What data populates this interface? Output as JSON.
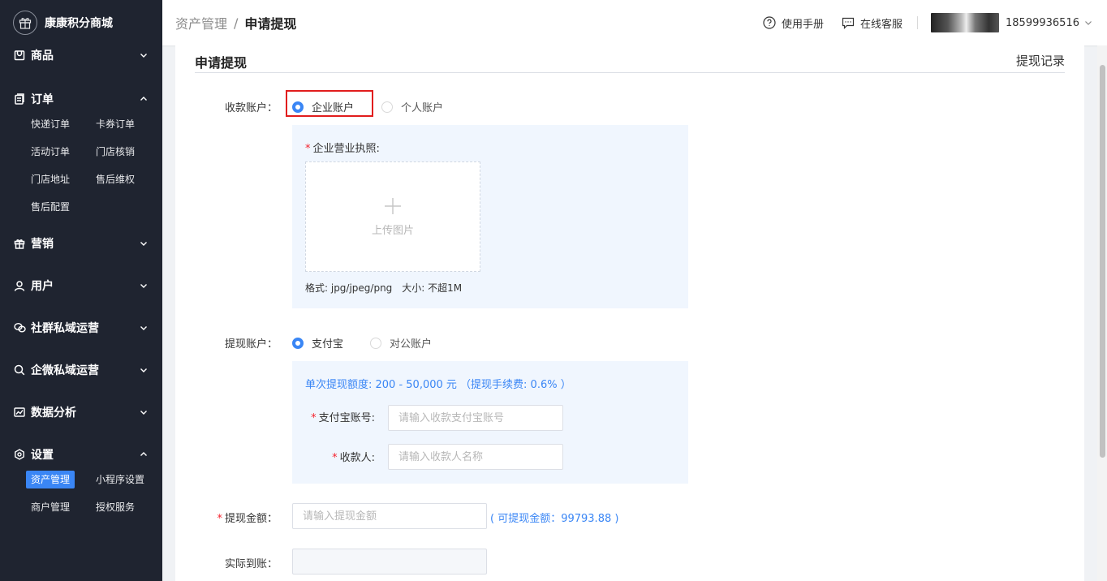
{
  "brand": {
    "name": "康康积分商城"
  },
  "sidebar": {
    "groups": [
      {
        "label": "商品",
        "icon": "goods-icon",
        "expanded": false,
        "items": []
      },
      {
        "label": "订单",
        "icon": "order-icon",
        "expanded": true,
        "items": [
          "快递订单",
          "卡券订单",
          "活动订单",
          "门店核销",
          "门店地址",
          "售后维权",
          "售后配置"
        ]
      },
      {
        "label": "营销",
        "icon": "gift-icon",
        "expanded": false,
        "items": []
      },
      {
        "label": "用户",
        "icon": "user-icon",
        "expanded": false,
        "items": []
      },
      {
        "label": "社群私域运营",
        "icon": "wechat-icon",
        "expanded": false,
        "items": []
      },
      {
        "label": "企微私域运营",
        "icon": "search-chat-icon",
        "expanded": false,
        "items": []
      },
      {
        "label": "数据分析",
        "icon": "chart-icon",
        "expanded": false,
        "items": []
      },
      {
        "label": "设置",
        "icon": "settings-icon",
        "expanded": true,
        "items": [
          "资产管理",
          "小程序设置",
          "商户管理",
          "授权服务"
        ],
        "active": "资产管理"
      }
    ]
  },
  "header": {
    "breadcrumb_parent": "资产管理",
    "breadcrumb_sep": "/",
    "breadcrumb_current": "申请提现",
    "manual": "使用手册",
    "service": "在线客服",
    "phone": "18599936516"
  },
  "form": {
    "title": "申请提现",
    "records_link": "提现记录",
    "account_label": "收款账户：",
    "account_options": [
      "企业账户",
      "个人账户"
    ],
    "account_selected": 0,
    "license_label": "企业营业执照:",
    "upload_text": "上传图片",
    "upload_hint": "格式: jpg/jpeg/png　大小: 不超1M",
    "withdraw_account_label": "提现账户：",
    "withdraw_options": [
      "支付宝",
      "对公账户"
    ],
    "withdraw_selected": 0,
    "limit_text": "单次提现额度: 200 - 50,000 元 （提现手续费: 0.6% ）",
    "alipay_label": "支付宝账号:",
    "alipay_placeholder": "请输入收款支付宝账号",
    "payee_label": "收款人:",
    "payee_placeholder": "请输入收款人名称",
    "amount_label": "提现金额：",
    "amount_placeholder": "请输入提现金额",
    "available_text": "( 可提现金额：99793.88 )",
    "actual_label": "实际到账："
  },
  "colors": {
    "accent": "#3a86f5",
    "sidebar_bg": "#1f2430",
    "highlight": "#e11d1d",
    "required": "#f5222d"
  }
}
